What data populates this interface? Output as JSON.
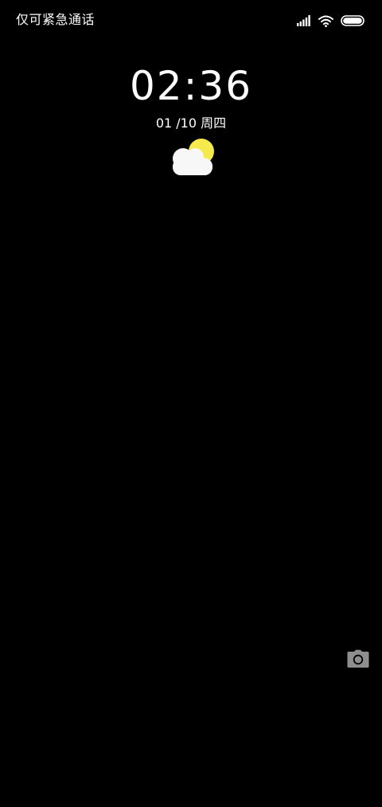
{
  "status_bar": {
    "carrier_text": "仅可紧急通话",
    "icons": [
      "signal-icon",
      "wifi-icon",
      "battery-icon"
    ]
  },
  "lock_screen": {
    "time": "02:36",
    "date": "01 /10 周四",
    "weather_icon": "partly-cloudy-icon",
    "shortcut_icon": "camera-icon"
  },
  "colors": {
    "background": "#000000",
    "text": "#ffffff",
    "sun": "#f5e94b",
    "cloud": "#f7f7f7",
    "camera": "#8e8e8e"
  }
}
